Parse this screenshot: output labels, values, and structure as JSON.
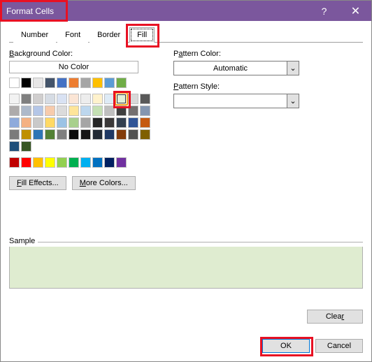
{
  "title": "Format Cells",
  "help_icon": "?",
  "close_icon": "✕",
  "tabs": [
    "Number",
    "Font",
    "Border",
    "Fill"
  ],
  "active_tab": "Fill",
  "left": {
    "bg_label": "Background Color:",
    "no_color": "No Color",
    "fill_effects": "Fill Effects...",
    "more_colors": "More Colors...",
    "grid1": [
      [
        "#ffffff",
        "#000000",
        "#e7e6e6",
        "#44546a",
        "#4472c4",
        "#ed7d31",
        "#a5a5a5",
        "#ffc000",
        "#5b9bd5",
        "#70ad47"
      ],
      [
        "#f2f2f2",
        "#7f7f7f",
        "#d0cece",
        "#d6dce4",
        "#d9e2f3",
        "#fbe5d5",
        "#ededed",
        "#fff2cc",
        "#deebf6",
        "#e2efd9"
      ],
      [
        "#d8d8d8",
        "#595959",
        "#aeabab",
        "#adb9ca",
        "#b4c6e7",
        "#f7cbac",
        "#dbdbdb",
        "#fee599",
        "#bdd7ee",
        "#c5e0b3"
      ],
      [
        "#bfbfbf",
        "#3f3f3f",
        "#757070",
        "#8496b0",
        "#8eaadb",
        "#f4b183",
        "#c9c9c9",
        "#ffd965",
        "#9cc3e5",
        "#a8d08d"
      ],
      [
        "#a5a5a5",
        "#262626",
        "#3a3838",
        "#323f4f",
        "#2f5496",
        "#c55a11",
        "#7b7b7b",
        "#bf9000",
        "#2e75b5",
        "#538135"
      ],
      [
        "#7f7f7f",
        "#0c0c0c",
        "#171616",
        "#222a35",
        "#1f3864",
        "#833c0b",
        "#525252",
        "#7f6000",
        "#1e4e79",
        "#375623"
      ]
    ],
    "selected_swatch": [
      1,
      9
    ],
    "standard": [
      "#c00000",
      "#ff0000",
      "#ffc000",
      "#ffff00",
      "#92d050",
      "#00b050",
      "#00b0f0",
      "#0070c0",
      "#002060",
      "#7030a0"
    ]
  },
  "right": {
    "pattern_color_label": "Pattern Color:",
    "pattern_color_value": "Automatic",
    "pattern_style_label": "Pattern Style:",
    "pattern_style_value": ""
  },
  "sample_label": "Sample",
  "clear_label": "Clear",
  "ok_label": "OK",
  "cancel_label": "Cancel",
  "chevron": "⌄"
}
